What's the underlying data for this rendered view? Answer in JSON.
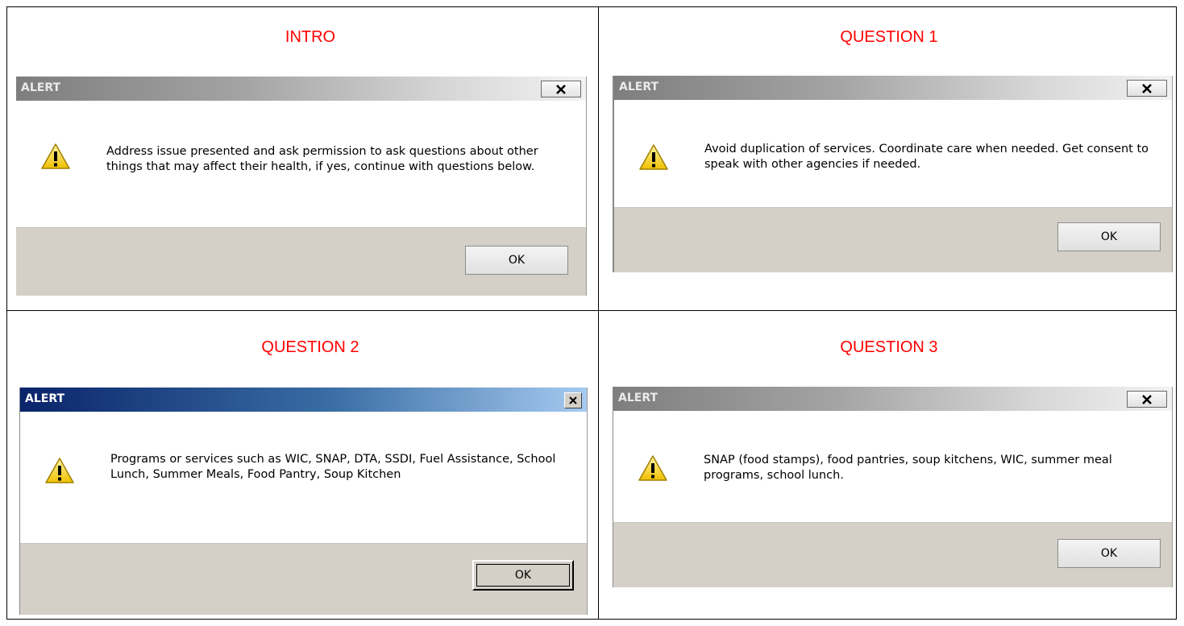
{
  "panels": [
    {
      "heading": "INTRO",
      "dialog_title": "ALERT",
      "close_glyph": "✕",
      "message": "Address issue presented and ask permission to ask questions about other things that may affect their health, if yes, continue with questions below.",
      "ok_label": "OK",
      "icon": "warning-icon"
    },
    {
      "heading": "QUESTION 1",
      "dialog_title": "ALERT",
      "close_glyph": "✕",
      "message": "Avoid duplication of services.  Coordinate care when needed.  Get consent to speak with other agencies if needed.",
      "ok_label": "OK",
      "icon": "warning-icon"
    },
    {
      "heading": "QUESTION 2",
      "dialog_title": "ALERT",
      "close_glyph": "✕",
      "message": "Programs or services such as WIC, SNAP, DTA, SSDI, Fuel Assistance, School Lunch, Summer Meals, Food Pantry, Soup Kitchen",
      "ok_label": "OK",
      "icon": "warning-icon"
    },
    {
      "heading": "QUESTION 3",
      "dialog_title": "ALERT",
      "close_glyph": "✕",
      "message": "SNAP (food stamps), food pantries, soup kitchens, WIC, summer meal programs, school lunch.",
      "ok_label": "OK",
      "icon": "warning-icon"
    }
  ],
  "colors": {
    "heading": "#ff0000",
    "classic_titlebar_start": "#0a246a",
    "classic_titlebar_end": "#a6caf0",
    "footer": "#d4d0c8"
  }
}
